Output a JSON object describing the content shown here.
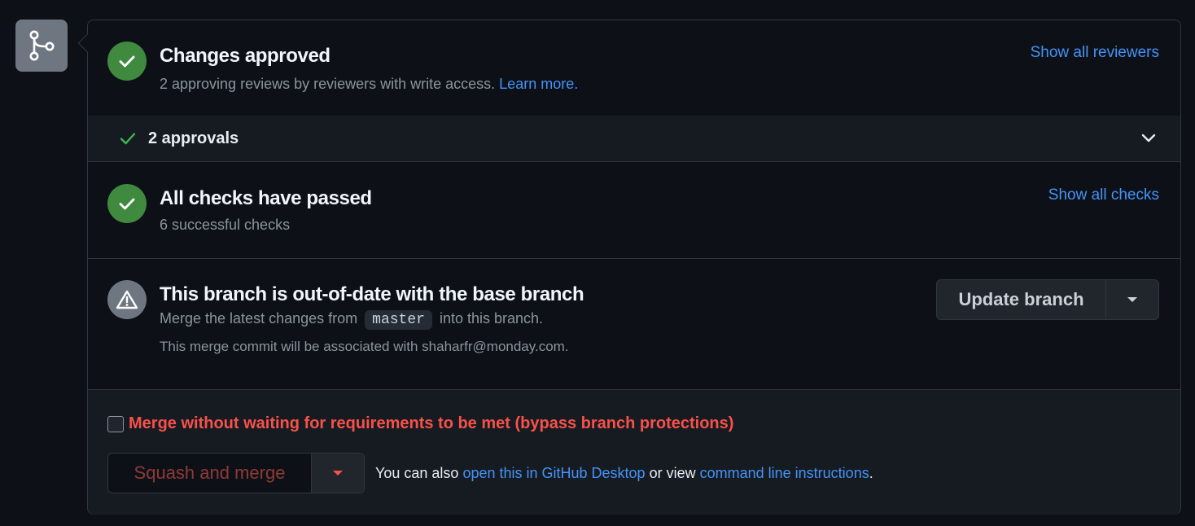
{
  "approved": {
    "title": "Changes approved",
    "subtitle": "2 approving reviews by reviewers with write access.",
    "learn_more": "Learn more.",
    "show_all": "Show all reviewers"
  },
  "approvals": {
    "label": "2 approvals"
  },
  "checks": {
    "title": "All checks have passed",
    "subtitle": "6 successful checks",
    "show_all": "Show all checks"
  },
  "branch": {
    "title": "This branch is out-of-date with the base branch",
    "line1_prefix": "Merge the latest changes from",
    "branch_name": "master",
    "line1_suffix": "into this branch.",
    "line2": "This merge commit will be associated with shaharfr@monday.com.",
    "update_button": "Update branch"
  },
  "merge": {
    "bypass_label": "Merge without waiting for requirements to be met (bypass branch protections)",
    "squash_button": "Squash and merge",
    "note_prefix": "You can also",
    "desktop_link": "open this in GitHub Desktop",
    "note_middle": "or view",
    "cli_link": "command line instructions",
    "note_suffix": "."
  },
  "colors": {
    "success": "#3f8a3f",
    "link": "#4493f8",
    "danger": "#f85149",
    "background": "#0d1117"
  },
  "icons": [
    "git-merge-icon",
    "check-icon",
    "alert-icon",
    "chevron-down-icon",
    "triangle-down-icon"
  ]
}
